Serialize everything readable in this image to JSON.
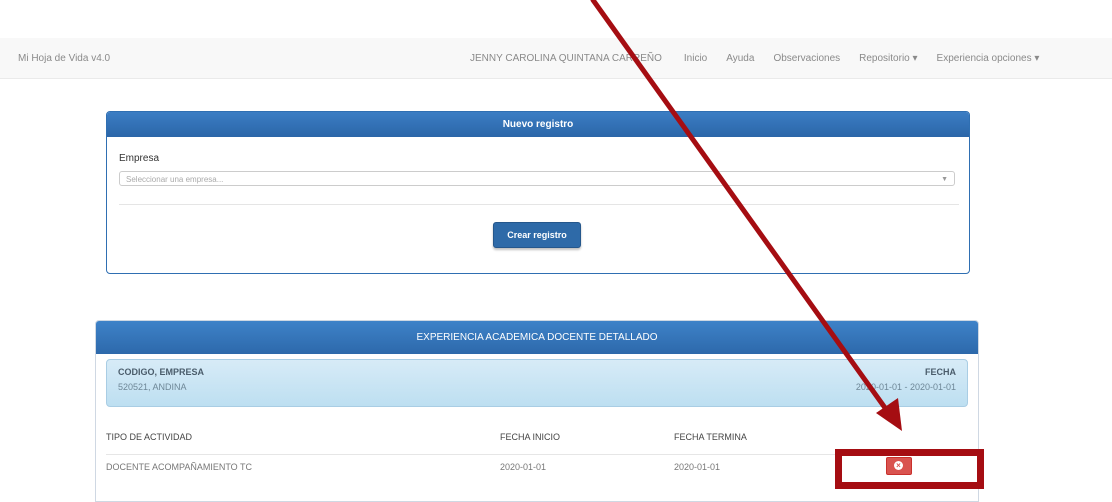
{
  "navbar": {
    "brand": "Mi Hoja de Vida v4.0",
    "user": "JENNY CAROLINA QUINTANA CARREÑO",
    "items": [
      {
        "label": "Inicio"
      },
      {
        "label": "Ayuda"
      },
      {
        "label": "Observaciones"
      },
      {
        "label": "Repositorio ▾"
      },
      {
        "label": "Experiencia opciones ▾"
      }
    ]
  },
  "nuevo": {
    "title": "Nuevo registro",
    "empresa_label": "Empresa",
    "empresa_placeholder": "Seleccionar una empresa...",
    "crear_label": "Crear registro"
  },
  "detalle": {
    "title": "EXPERIENCIA ACADEMICA DOCENTE DETALLADO",
    "codigo_label": "CODIGO, EMPRESA",
    "codigo_value": "520521, ANDINA",
    "fecha_label": "FECHA",
    "fecha_value": "2020-01-01 - 2020-01-01",
    "columns": {
      "tipo": "TIPO DE ACTIVIDAD",
      "inicio": "FECHA INICIO",
      "termina": "FECHA TERMINA"
    },
    "rows": [
      {
        "tipo": "DOCENTE ACOMPAÑAMIENTO TC",
        "inicio": "2020-01-01",
        "termina": "2020-01-01"
      }
    ]
  },
  "annotation": {
    "color": "#a50d12"
  }
}
